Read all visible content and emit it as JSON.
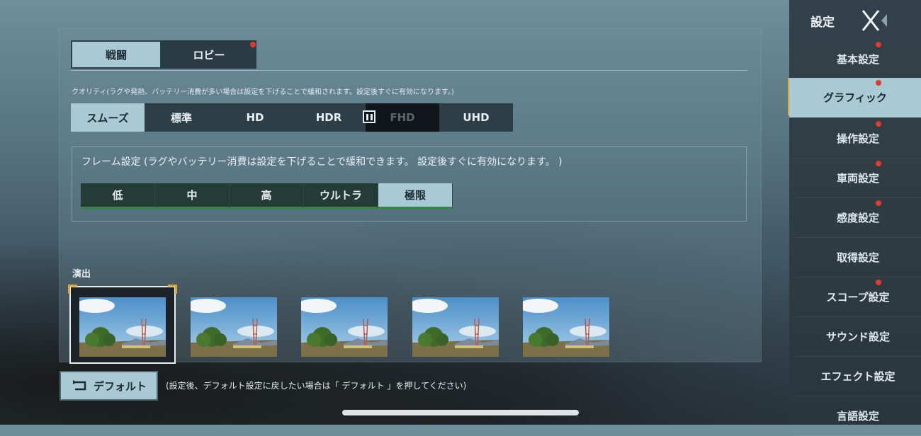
{
  "tabs": [
    {
      "label": "戦闘",
      "active": true
    },
    {
      "label": "ロビー",
      "active": false,
      "badge": true
    }
  ],
  "quality": {
    "note": "クオリティ(ラグや発熱、バッテリー消費が多い場合は設定を下げることで緩和されます。設定後すぐに有効になります。)",
    "options": [
      "スムーズ",
      "標準",
      "HD",
      "HDR",
      "FHD",
      "UHD"
    ],
    "selected": "スムーズ",
    "disabled": "FHD"
  },
  "frame": {
    "note": "フレーム設定 (ラグやバッテリー消費は設定を下げることで緩和できます。 設定後すぐに有効になります。 )",
    "options": [
      "低",
      "中",
      "高",
      "ウルトラ",
      "極限"
    ],
    "selected": "極限"
  },
  "effects": {
    "label": "演出",
    "thumbnail_count": 5,
    "selected_index": 0
  },
  "footer": {
    "default_label": "デフォルト",
    "note": "(設定後、デフォルト設定に戻したい場合は「 デフォルト 」を押してください)"
  },
  "sidebar": {
    "title": "設定",
    "items": [
      {
        "label": "基本設定",
        "badge": true,
        "active": false
      },
      {
        "label": "グラフィック",
        "badge": true,
        "active": true
      },
      {
        "label": "操作設定",
        "badge": true,
        "active": false
      },
      {
        "label": "車両設定",
        "badge": true,
        "active": false
      },
      {
        "label": "感度設定",
        "badge": true,
        "active": false
      },
      {
        "label": "取得設定",
        "badge": false,
        "active": false
      },
      {
        "label": "スコープ設定",
        "badge": true,
        "active": false
      },
      {
        "label": "サウンド設定",
        "badge": false,
        "active": false
      },
      {
        "label": "エフェクト設定",
        "badge": false,
        "active": false
      },
      {
        "label": "言語設定",
        "badge": false,
        "active": false
      }
    ]
  },
  "colors": {
    "accent": "#a9c9d4",
    "badge": "#e23b2e",
    "sidebar_active_marker": "#e3a62a",
    "frame_underline": "#2a8c3c"
  }
}
